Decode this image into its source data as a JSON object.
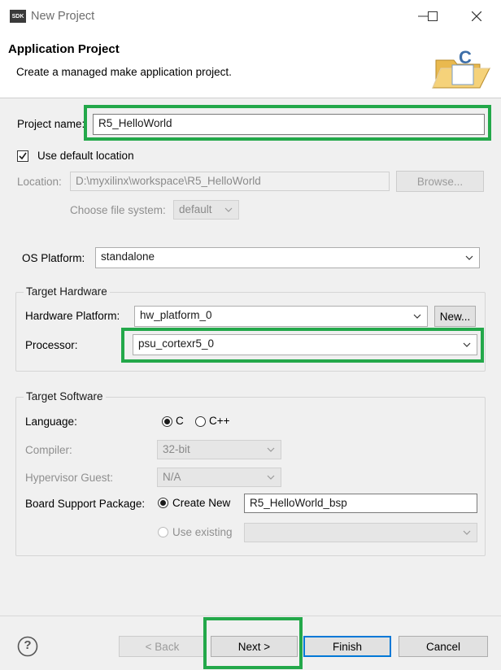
{
  "window": {
    "app_badge": "SDK",
    "title": "New Project"
  },
  "header": {
    "title": "Application Project",
    "description": "Create a managed make application project."
  },
  "project": {
    "name_label": "Project name:",
    "name_value": "R5_HelloWorld",
    "use_default_location_label": "Use default location",
    "use_default_location_checked": true,
    "location_label": "Location:",
    "location_value": "D:\\myxilinx\\workspace\\R5_HelloWorld",
    "browse_label": "Browse...",
    "file_system_label": "Choose file system:",
    "file_system_value": "default"
  },
  "os_platform": {
    "label": "OS Platform:",
    "value": "standalone"
  },
  "target_hardware": {
    "title": "Target Hardware",
    "hw_platform_label": "Hardware Platform:",
    "hw_platform_value": "hw_platform_0",
    "new_label": "New...",
    "processor_label": "Processor:",
    "processor_value": "psu_cortexr5_0"
  },
  "target_software": {
    "title": "Target Software",
    "language_label": "Language:",
    "language_options": [
      "C",
      "C++"
    ],
    "language_selected": "C",
    "compiler_label": "Compiler:",
    "compiler_value": "32-bit",
    "hypervisor_label": "Hypervisor Guest:",
    "hypervisor_value": "N/A",
    "bsp_label": "Board Support Package:",
    "bsp_create_new_label": "Create New",
    "bsp_create_new_value": "R5_HelloWorld_bsp",
    "bsp_use_existing_label": "Use existing",
    "bsp_selected": "Create New"
  },
  "footer": {
    "help_label": "?",
    "back_label": "< Back",
    "next_label": "Next >",
    "finish_label": "Finish",
    "cancel_label": "Cancel"
  },
  "colors": {
    "highlight": "#23a84a",
    "default_button_border": "#0078d7",
    "dialog_bg": "#f0f0f0"
  }
}
